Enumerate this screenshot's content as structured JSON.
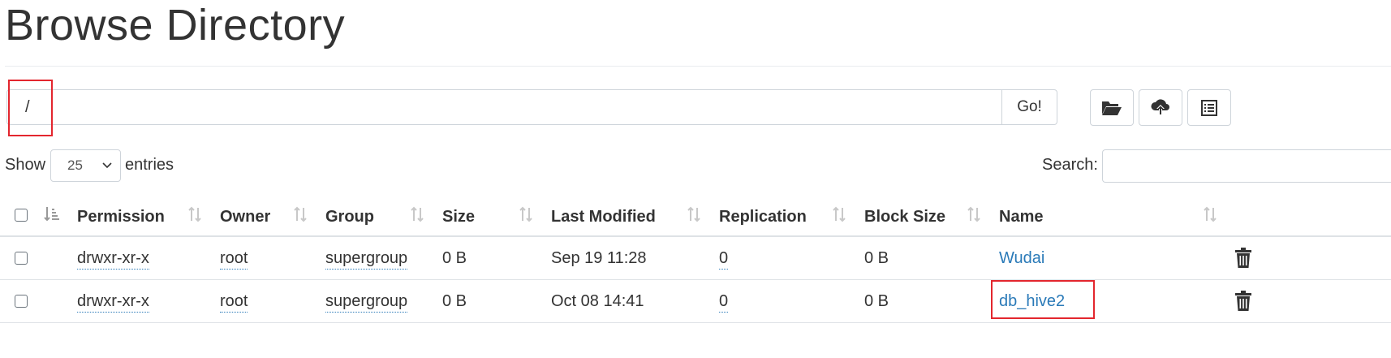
{
  "page": {
    "title": "Browse Directory"
  },
  "path_bar": {
    "value": "/",
    "go_label": "Go!"
  },
  "toolbar": {
    "buttons": [
      {
        "icon": "folder-open-icon"
      },
      {
        "icon": "cloud-upload-icon"
      },
      {
        "icon": "list-icon"
      }
    ]
  },
  "length_control": {
    "show_label": "Show",
    "selected": "25",
    "entries_label": "entries"
  },
  "search": {
    "label": "Search:",
    "value": ""
  },
  "table": {
    "columns": [
      "Permission",
      "Owner",
      "Group",
      "Size",
      "Last Modified",
      "Replication",
      "Block Size",
      "Name"
    ],
    "rows": [
      {
        "permission": "drwxr-xr-x",
        "owner": "root",
        "group": "supergroup",
        "size": "0 B",
        "last_modified": "Sep 19 11:28",
        "replication": "0",
        "block_size": "0 B",
        "name": "Wudai"
      },
      {
        "permission": "drwxr-xr-x",
        "owner": "root",
        "group": "supergroup",
        "size": "0 B",
        "last_modified": "Oct 08 14:41",
        "replication": "0",
        "block_size": "0 B",
        "name": "db_hive2"
      }
    ]
  },
  "colors": {
    "link": "#2a7ab8",
    "highlight": "#e3262e",
    "text": "#333333"
  }
}
